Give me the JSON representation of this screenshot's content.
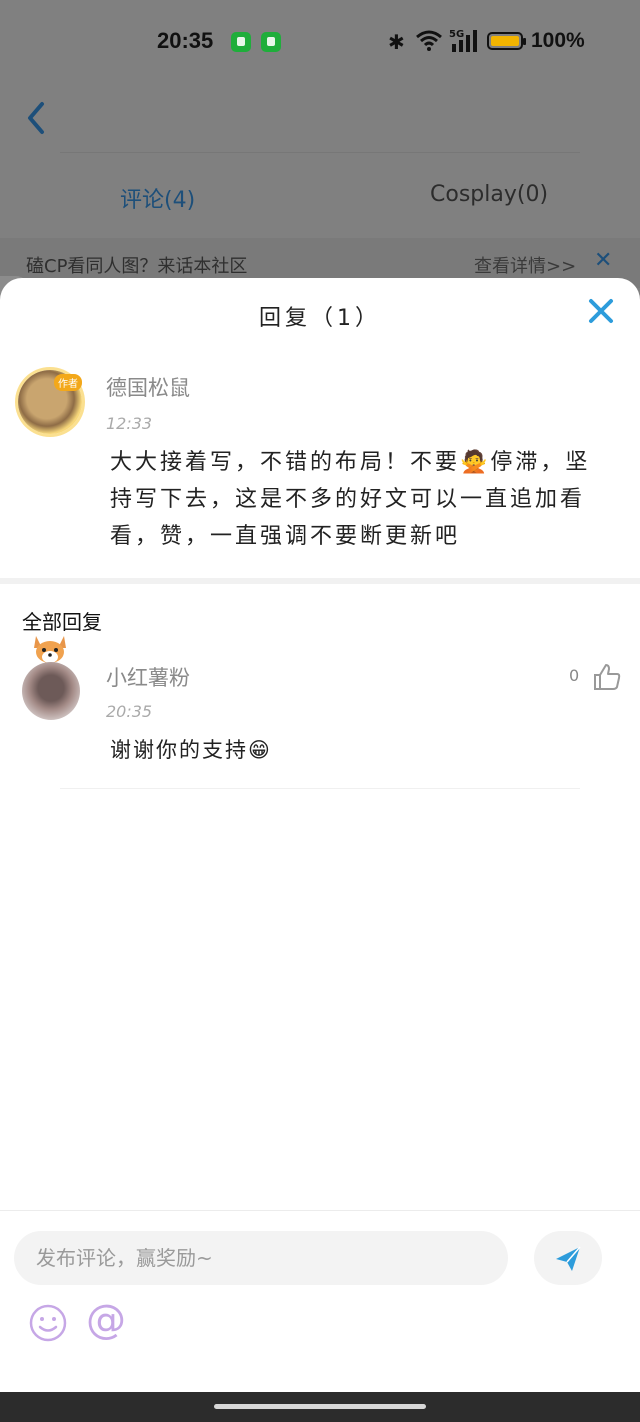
{
  "status_bar": {
    "time": "20:35",
    "network": "5G",
    "battery": "100%"
  },
  "tabs": [
    {
      "label": "评论(4)"
    },
    {
      "label": "Cosplay(0)"
    }
  ],
  "banner": {
    "text": "磕CP看同人图？来话本社区",
    "link": "查看详情>>"
  },
  "sheet": {
    "title": "回复（1）",
    "comment": {
      "author_badge": "作者",
      "username": "德国松鼠",
      "time": "12:33",
      "text": "大大接着写，不错的布局！不要🙅停滞，坚持写下去，这是不多的好文可以一直追加看看，赞，一直强调不要断更新吧"
    },
    "all_replies_label": "全部回复",
    "replies": [
      {
        "username": "小红薯粉",
        "time": "20:35",
        "text": "谢谢你的支持😁",
        "likes": "0"
      }
    ]
  },
  "input": {
    "placeholder": "发布评论，赢奖励~"
  },
  "colors": {
    "accent": "#2d9cdb",
    "overlay": "#808080"
  }
}
